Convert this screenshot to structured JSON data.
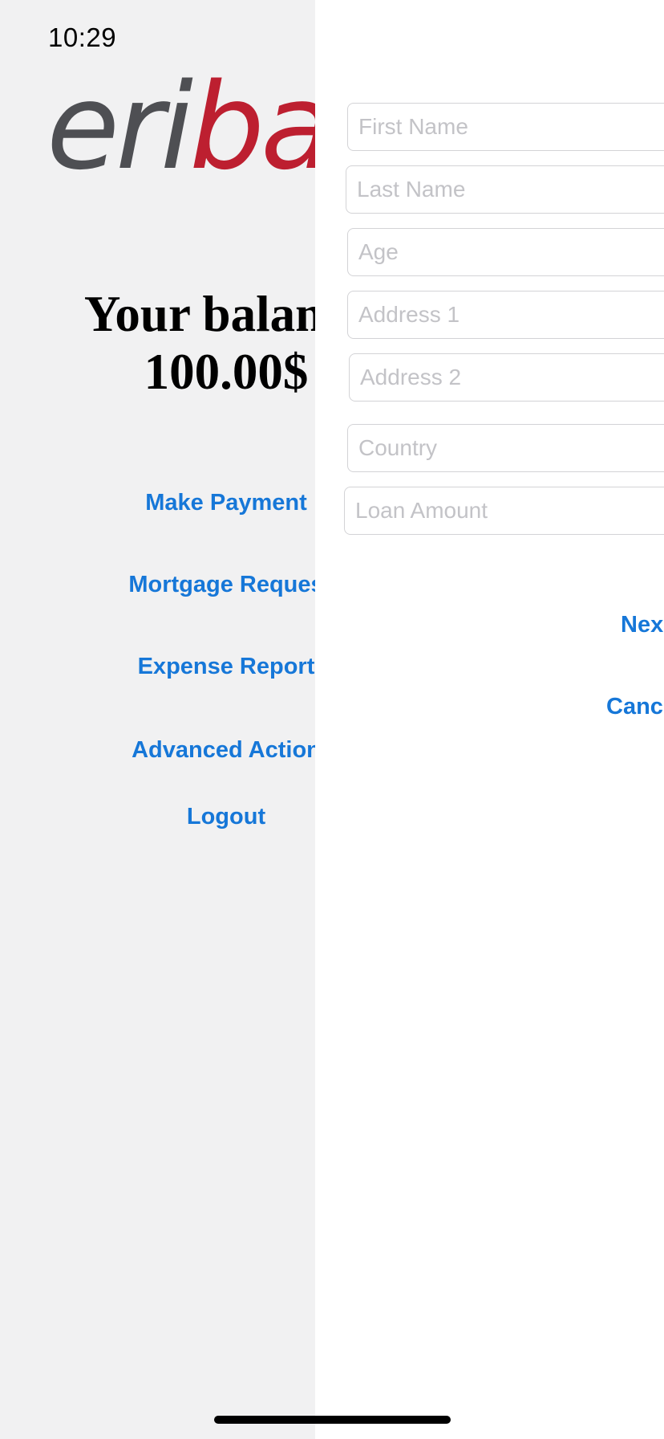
{
  "status_bar": {
    "time": "10:29",
    "battery_state": "charging",
    "battery_color": "#34c759"
  },
  "home": {
    "logo_part_grey": "eri",
    "logo_part_red": "ban",
    "balance_label": "Your balance",
    "balance_value": "100.00$",
    "menu": {
      "make_payment": "Make Payment",
      "mortgage_request": "Mortgage Reques",
      "expense_report": "Expense Report",
      "advanced_actions": "Advanced Action",
      "logout": "Logout"
    }
  },
  "form": {
    "first_name": {
      "value": "",
      "placeholder": "First Name"
    },
    "last_name": {
      "value": "",
      "placeholder": "Last Name"
    },
    "age": {
      "value": "",
      "placeholder": "Age"
    },
    "address_1": {
      "value": "",
      "placeholder": "Address 1"
    },
    "address_2": {
      "value": "",
      "placeholder": "Address 2"
    },
    "country": {
      "value": "",
      "placeholder": "Country"
    },
    "loan_amount": {
      "value": "",
      "placeholder": "Loan Amount"
    },
    "next_label": "Nex",
    "cancel_label": "Canc"
  },
  "colors": {
    "link_blue": "#1677d8",
    "logo_grey": "#4e4f53",
    "logo_red": "#bd1f30",
    "background": "#f1f1f2"
  }
}
